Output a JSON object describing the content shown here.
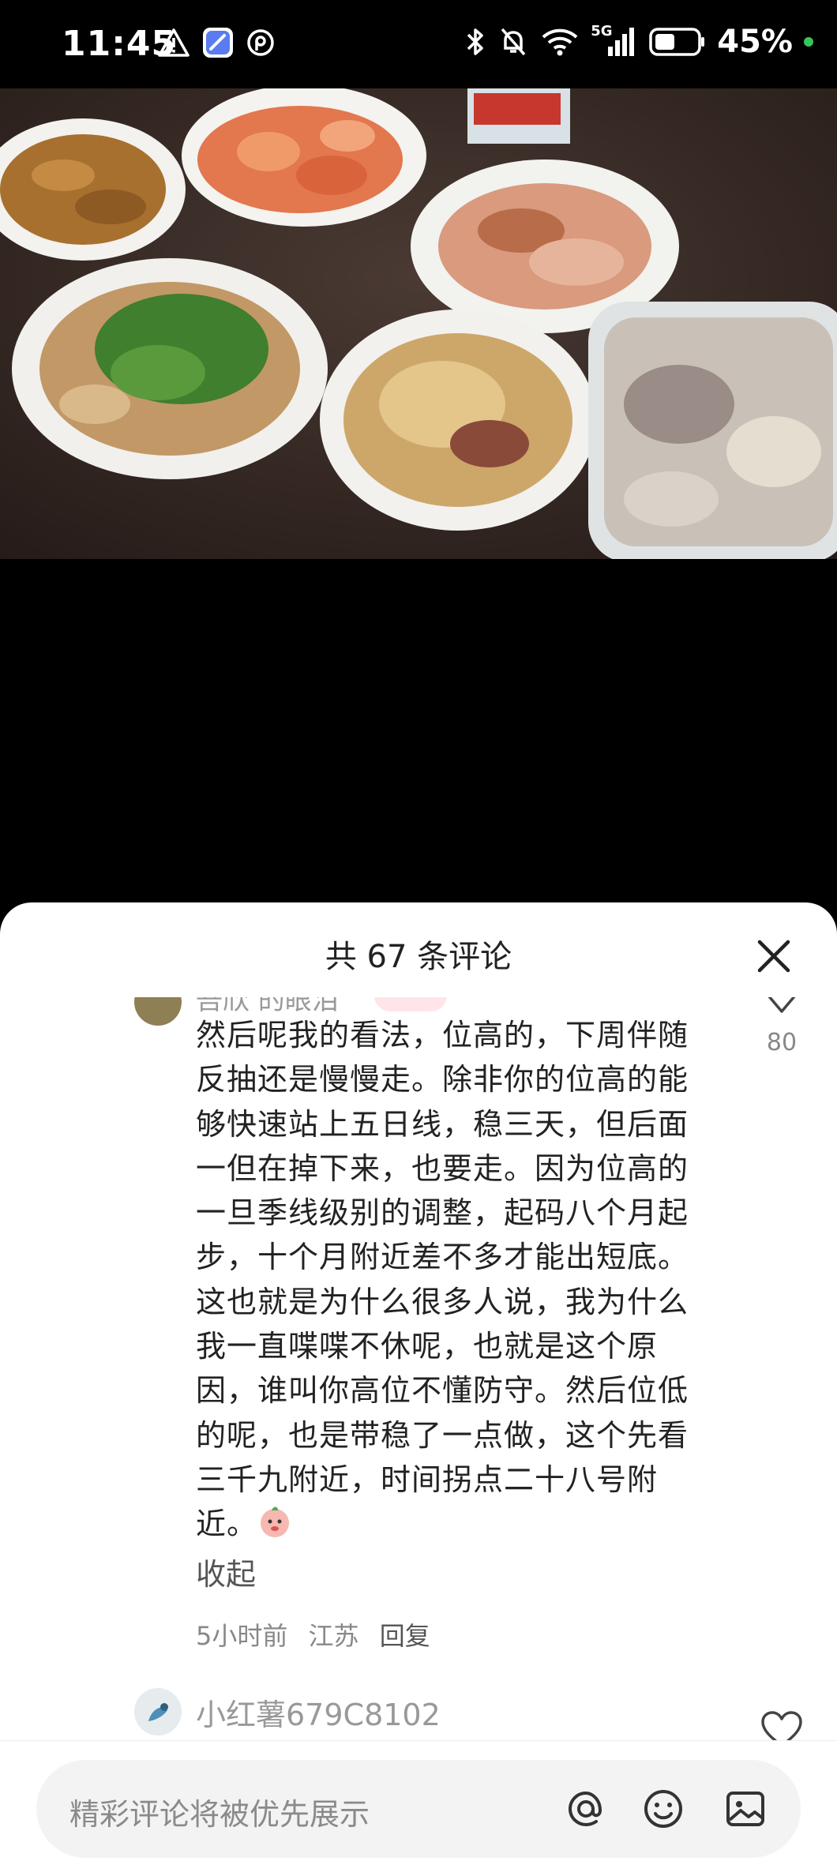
{
  "status_bar": {
    "time": "11:45",
    "battery_percent": "45%",
    "network": "5G",
    "icons": [
      "warning-icon",
      "app-icon",
      "p-icon",
      "bluetooth-icon",
      "mute-icon",
      "wifi-icon",
      "signal-icon",
      "battery-icon"
    ]
  },
  "comments_sheet": {
    "title": "共 67 条评论",
    "comments": [
      {
        "name_partial": "吾欣 的眼泪",
        "likes": "80",
        "text": "然后呢我的看法，位高的，下周伴随反抽还是慢慢走。除非你的位高的能够快速站上五日线，稳三天，但后面一但在掉下来，也要走。因为位高的一旦季线级别的调整，起码八个月起步，十个月附近差不多才能出短底。这也就是为什么很多人说，我为什么我一直喋喋不休呢，也就是这个原因，谁叫你高位不懂防守。然后位低的呢，也是带稳了一点做，这个先看三千九附近，时间拐点二十八号附近。",
        "collapse_label": "收起",
        "time_ago": "5小时前",
        "location": "江苏",
        "reply_label": "回复"
      },
      {
        "name": "小红薯679C8102"
      }
    ]
  },
  "input_bar": {
    "placeholder": "精彩评论将被优先展示"
  }
}
